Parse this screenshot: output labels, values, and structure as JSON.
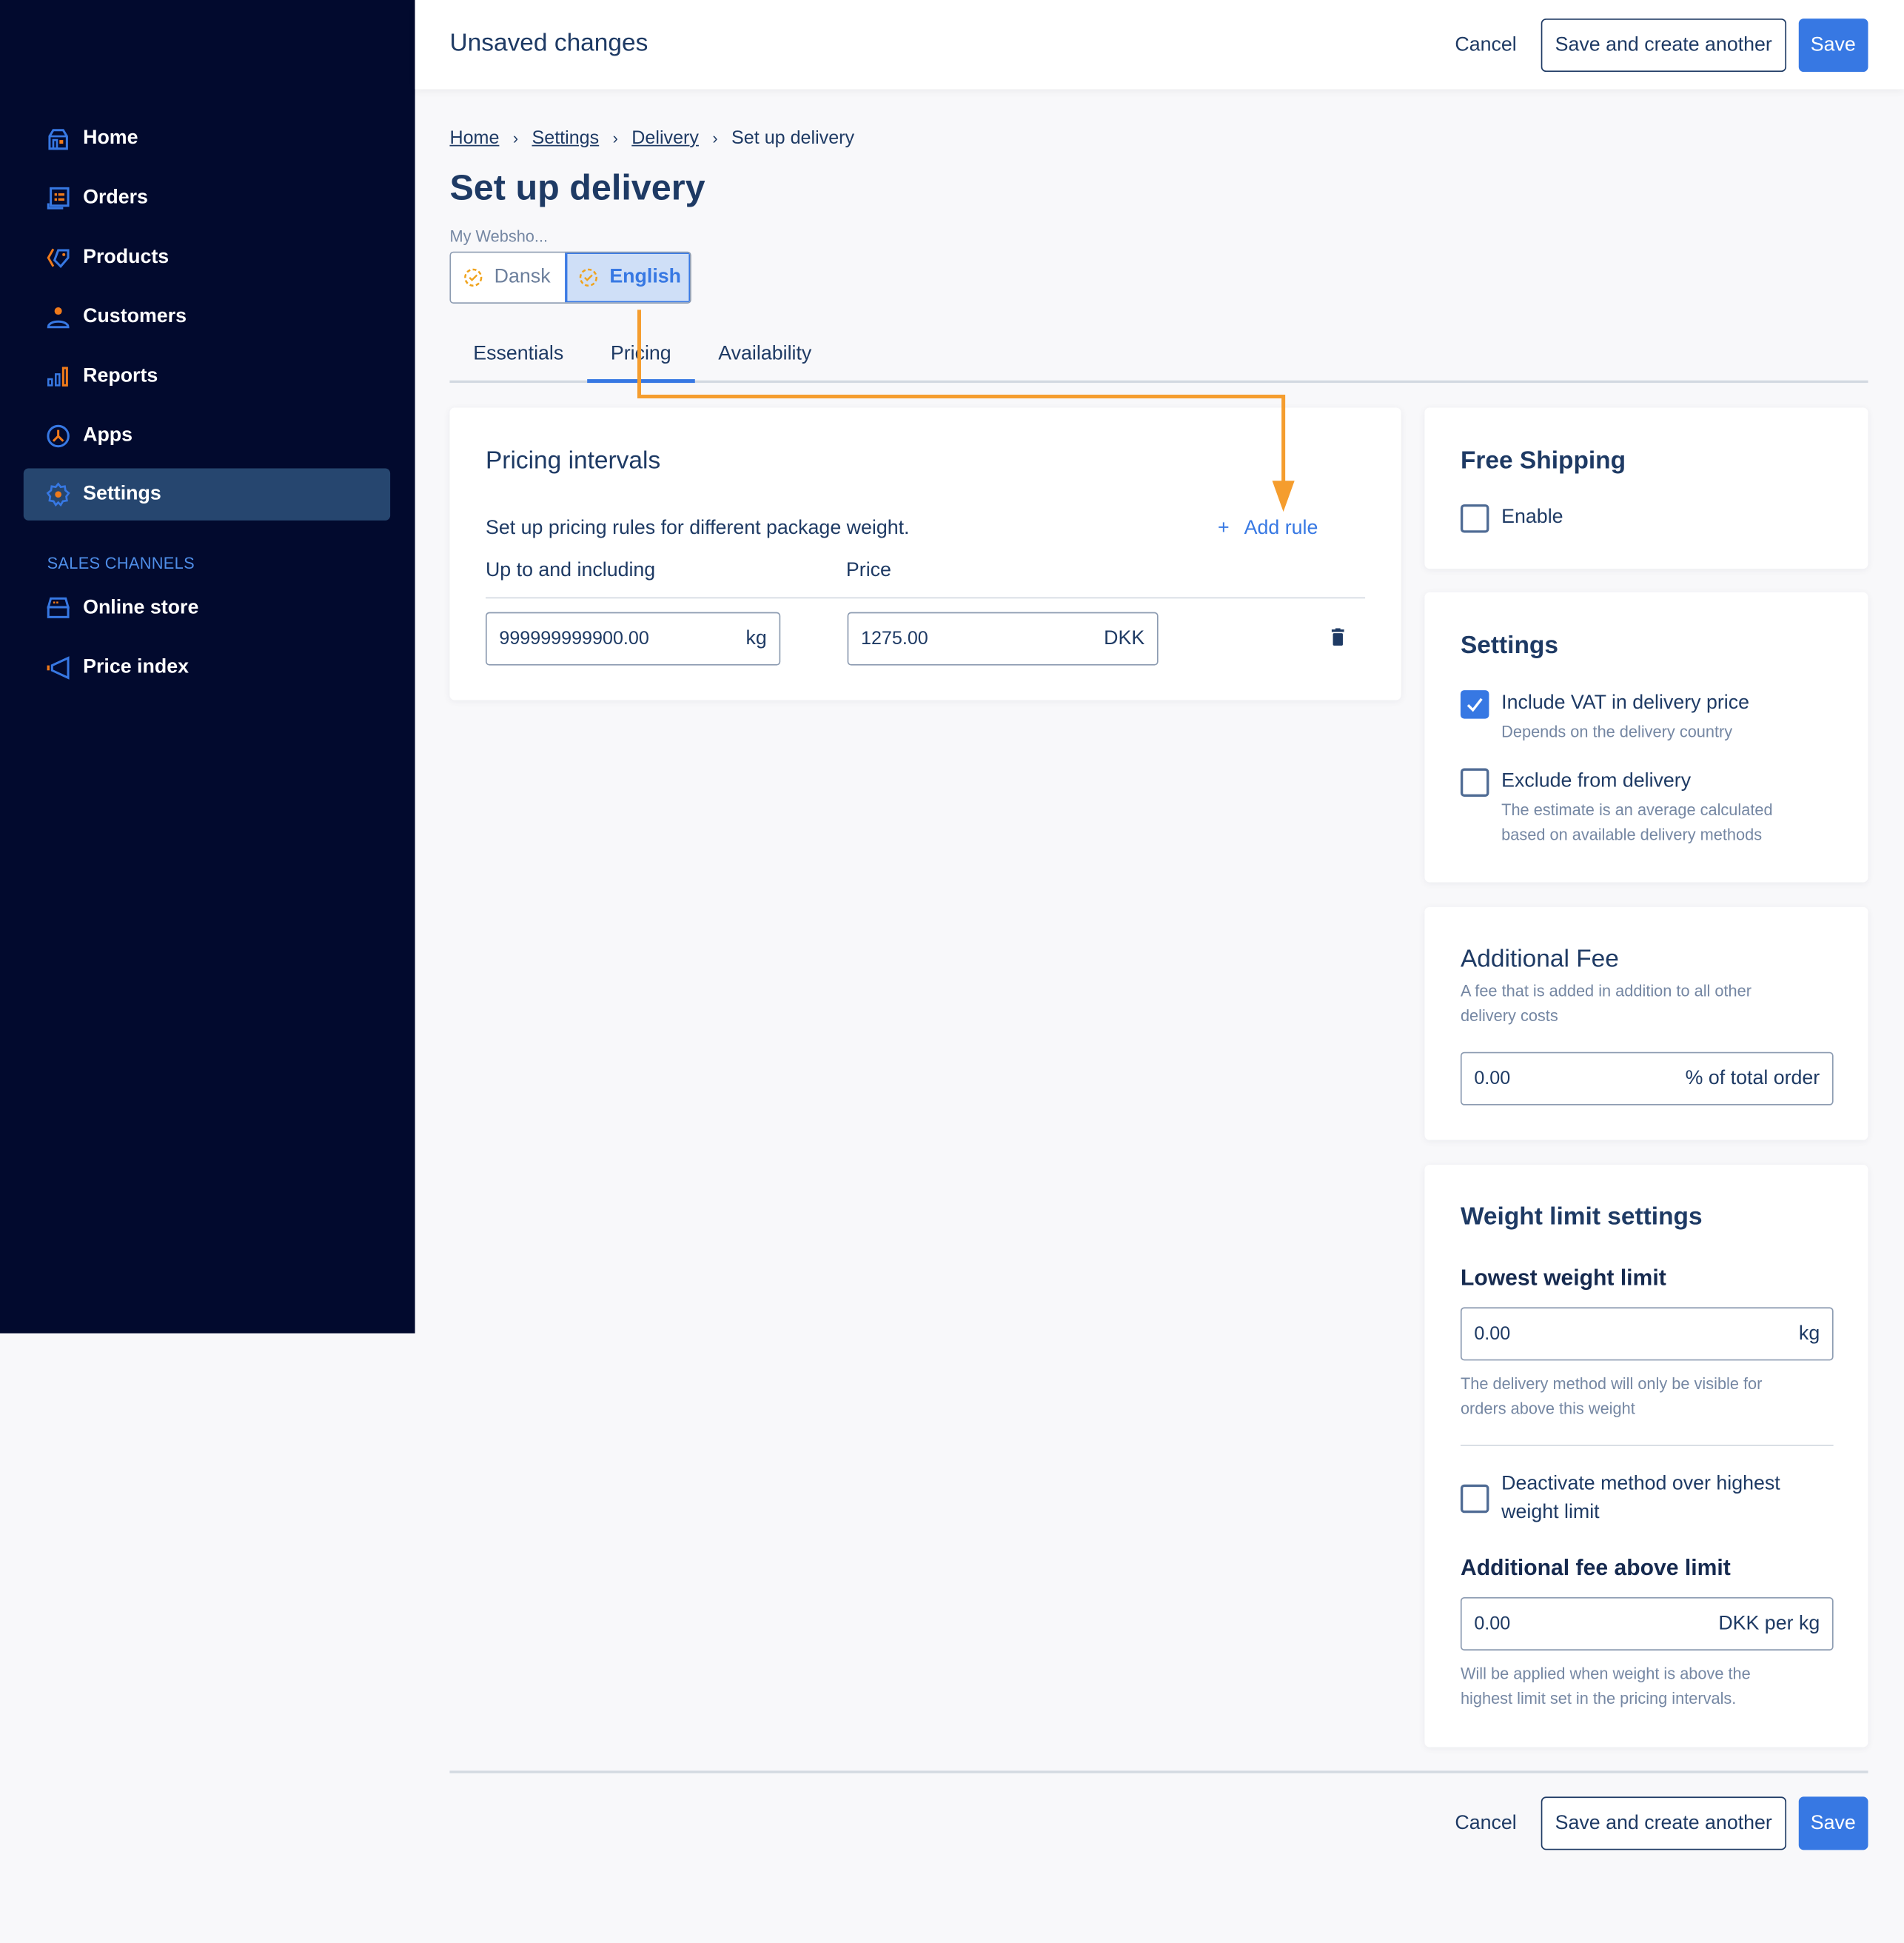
{
  "header": {
    "title": "Unsaved changes",
    "cancel_label": "Cancel",
    "save_another_label": "Save and create another",
    "save_label": "Save"
  },
  "sidebar": {
    "items": [
      {
        "label": "Home",
        "icon": "home-icon"
      },
      {
        "label": "Orders",
        "icon": "orders-icon"
      },
      {
        "label": "Products",
        "icon": "tag-icon"
      },
      {
        "label": "Customers",
        "icon": "user-icon"
      },
      {
        "label": "Reports",
        "icon": "bar-chart-icon"
      },
      {
        "label": "Apps",
        "icon": "apps-icon"
      },
      {
        "label": "Settings",
        "icon": "gear-icon",
        "active": true
      }
    ],
    "section_label": "SALES CHANNELS",
    "channels": [
      {
        "label": "Online store",
        "icon": "store-icon"
      },
      {
        "label": "Price index",
        "icon": "megaphone-icon"
      }
    ]
  },
  "breadcrumb": {
    "items": [
      "Home",
      "Settings",
      "Delivery"
    ],
    "current": "Set up delivery"
  },
  "page": {
    "title": "Set up delivery",
    "shop_name": "My Websho...",
    "languages": [
      {
        "label": "Dansk",
        "selected": false
      },
      {
        "label": "English",
        "selected": true
      }
    ]
  },
  "tabs": [
    {
      "label": "Essentials",
      "active": false
    },
    {
      "label": "Pricing",
      "active": true
    },
    {
      "label": "Availability",
      "active": false
    }
  ],
  "pricing": {
    "title": "Pricing intervals",
    "description": "Set up pricing rules for different package weight.",
    "add_rule_label": "Add rule",
    "col_weight": "Up to and including",
    "col_price": "Price",
    "rows": [
      {
        "weight": "999999999900.00",
        "weight_unit": "kg",
        "price": "1275.00",
        "currency": "DKK"
      }
    ]
  },
  "free_shipping": {
    "title": "Free Shipping",
    "enable_label": "Enable",
    "enabled": false
  },
  "settings_card": {
    "title": "Settings",
    "include_vat_label": "Include VAT in delivery price",
    "include_vat_help": "Depends on the delivery country",
    "include_vat": true,
    "exclude_label": "Exclude from delivery",
    "exclude_help_1": "The estimate is an average calculated",
    "exclude_help_2": "based on available delivery methods",
    "exclude": false
  },
  "additional_fee": {
    "title": "Additional Fee",
    "help_1": "A fee that is added in addition to all other",
    "help_2": "delivery costs",
    "value": "0.00",
    "unit": "% of total order"
  },
  "weight_limit": {
    "title": "Weight limit settings",
    "lowest_label": "Lowest weight limit",
    "lowest_value": "0.00",
    "lowest_unit": "kg",
    "lowest_help_1": "The delivery method will only be visible for",
    "lowest_help_2": "orders above this weight",
    "deactivate_label_1": "Deactivate method over highest",
    "deactivate_label_2": "weight limit",
    "deactivate": false,
    "fee_label": "Additional fee above limit",
    "fee_value": "0.00",
    "fee_unit": "DKK per kg",
    "fee_help_1": "Will be applied when weight is above the",
    "fee_help_2": "highest limit set in the pricing intervals."
  },
  "footer": {
    "cancel_label": "Cancel",
    "save_another_label": "Save and create another",
    "save_label": "Save"
  },
  "colors": {
    "sidebar_bg": "#020a2e",
    "accent": "#3778e3",
    "annotation": "#f59d2e",
    "text": "#1e3a64"
  }
}
